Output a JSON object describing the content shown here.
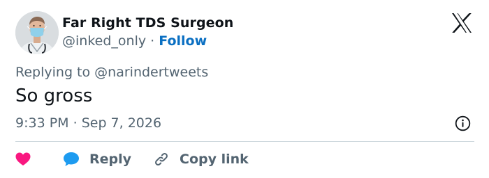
{
  "author": {
    "display_name": "Far Right TDS Surgeon",
    "handle": "@inked_only",
    "separator": "·",
    "follow_label": "Follow"
  },
  "tweet": {
    "replying_prefix": "Replying to",
    "replying_to": "@narindertweets",
    "text": "So gross",
    "time": "9:33 PM",
    "separator": "·",
    "date": "Sep 7, 2026"
  },
  "actions": {
    "reply_label": "Reply",
    "copy_link_label": "Copy link"
  },
  "icons": {
    "brand": "x-logo-icon",
    "info": "info-icon",
    "like": "heart-icon",
    "reply": "speech-bubble-icon",
    "copy": "link-icon"
  },
  "colors": {
    "text": "#0f1419",
    "secondary": "#536471",
    "follow": "#0a6fc2",
    "like": "#f91880",
    "reply": "#1d9bf0",
    "divider": "#cfd9de"
  }
}
